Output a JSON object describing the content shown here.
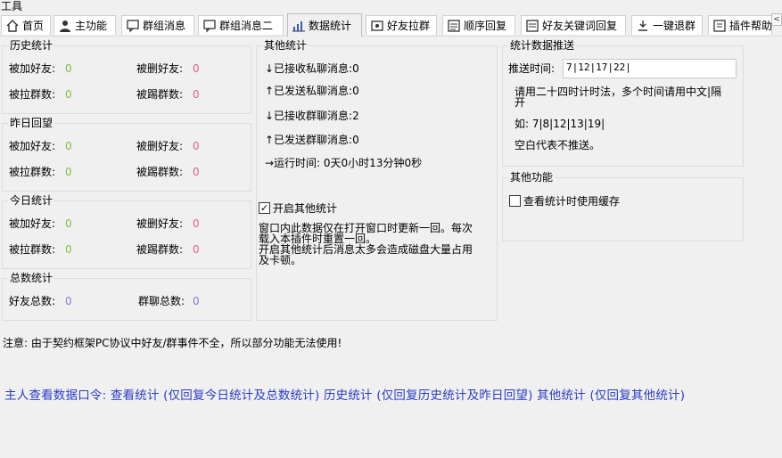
{
  "window": {
    "title": "工具"
  },
  "tabs": [
    {
      "label": "首页",
      "icon": "home-icon"
    },
    {
      "label": "主功能",
      "icon": "user-icon"
    },
    {
      "label": "群组消息",
      "icon": "group-message-icon"
    },
    {
      "label": "群组消息二",
      "icon": "group-message-icon"
    },
    {
      "label": "数据统计",
      "icon": "chart-icon",
      "active": true
    },
    {
      "label": "好友拉群",
      "icon": "invite-icon"
    },
    {
      "label": "顺序回复",
      "icon": "list-icon"
    },
    {
      "label": "好友关键词回复",
      "icon": "keyword-icon"
    },
    {
      "label": "一键退群",
      "icon": "exit-icon"
    },
    {
      "label": "插件帮助",
      "icon": "help-icon"
    }
  ],
  "tab_scroll": "<",
  "history": {
    "title": "历史统计",
    "added_friends_label": "被加好友:",
    "added_friends": "0",
    "deleted_friends_label": "被删好友:",
    "deleted_friends": "0",
    "pulled_groups_label": "被拉群数:",
    "pulled_groups": "0",
    "kicked_groups_label": "被踢群数:",
    "kicked_groups": "0"
  },
  "yesterday": {
    "title": "昨日回望",
    "added_friends_label": "被加好友:",
    "added_friends": "0",
    "deleted_friends_label": "被删好友:",
    "deleted_friends": "0",
    "pulled_groups_label": "被拉群数:",
    "pulled_groups": "0",
    "kicked_groups_label": "被踢群数:",
    "kicked_groups": "0"
  },
  "today": {
    "title": "今日统计",
    "added_friends_label": "被加好友:",
    "added_friends": "0",
    "deleted_friends_label": "被删好友:",
    "deleted_friends": "0",
    "pulled_groups_label": "被拉群数:",
    "pulled_groups": "0",
    "kicked_groups_label": "被踢群数:",
    "kicked_groups": "0"
  },
  "total": {
    "title": "总数统计",
    "friends_label": "好友总数:",
    "friends": "0",
    "groups_label": "群聊总数:",
    "groups": "0"
  },
  "other_stats": {
    "title": "其他统计",
    "recv_private": "↓已接收私聊消息:0",
    "sent_private": "↑已发送私聊消息:0",
    "recv_group": "↓已接收群聊消息:2",
    "sent_group": "↑已发送群聊消息:0",
    "runtime": "→运行时间: 0天0小时13分钟0秒",
    "enable_label": "开启其他统计",
    "enable_checked": true,
    "checkbox_mark": "✓",
    "note_line1": "窗口内此数据仅在打开窗口时更新一回。每次",
    "note_line2": "载入本插件时重置一回。",
    "note_line3": "开启其他统计后消息太多会造成磁盘大量占用",
    "note_line4": "及卡顿。"
  },
  "push": {
    "title": "统计数据推送",
    "time_label": "推送时间:",
    "time_value": "7|12|17|22|",
    "hint_line1": "请用二十四时计时法，多个时间请用中文|隔",
    "hint_line2": "开",
    "example": "如: 7|8|12|13|19|",
    "blank_note": "空白代表不推送。"
  },
  "other_func": {
    "title": "其他功能",
    "cache_label": "查看统计时使用缓存",
    "cache_checked": false
  },
  "notice": "注意: 由于契约框架PC协议中好友/群事件不全，所以部分功能无法使用!",
  "commands": "主人查看数据口令: 查看统计 (仅回复今日统计及总数统计) 历史统计 (仅回复历史统计及昨日回望) 其他统计 (仅回复其他统计)"
}
